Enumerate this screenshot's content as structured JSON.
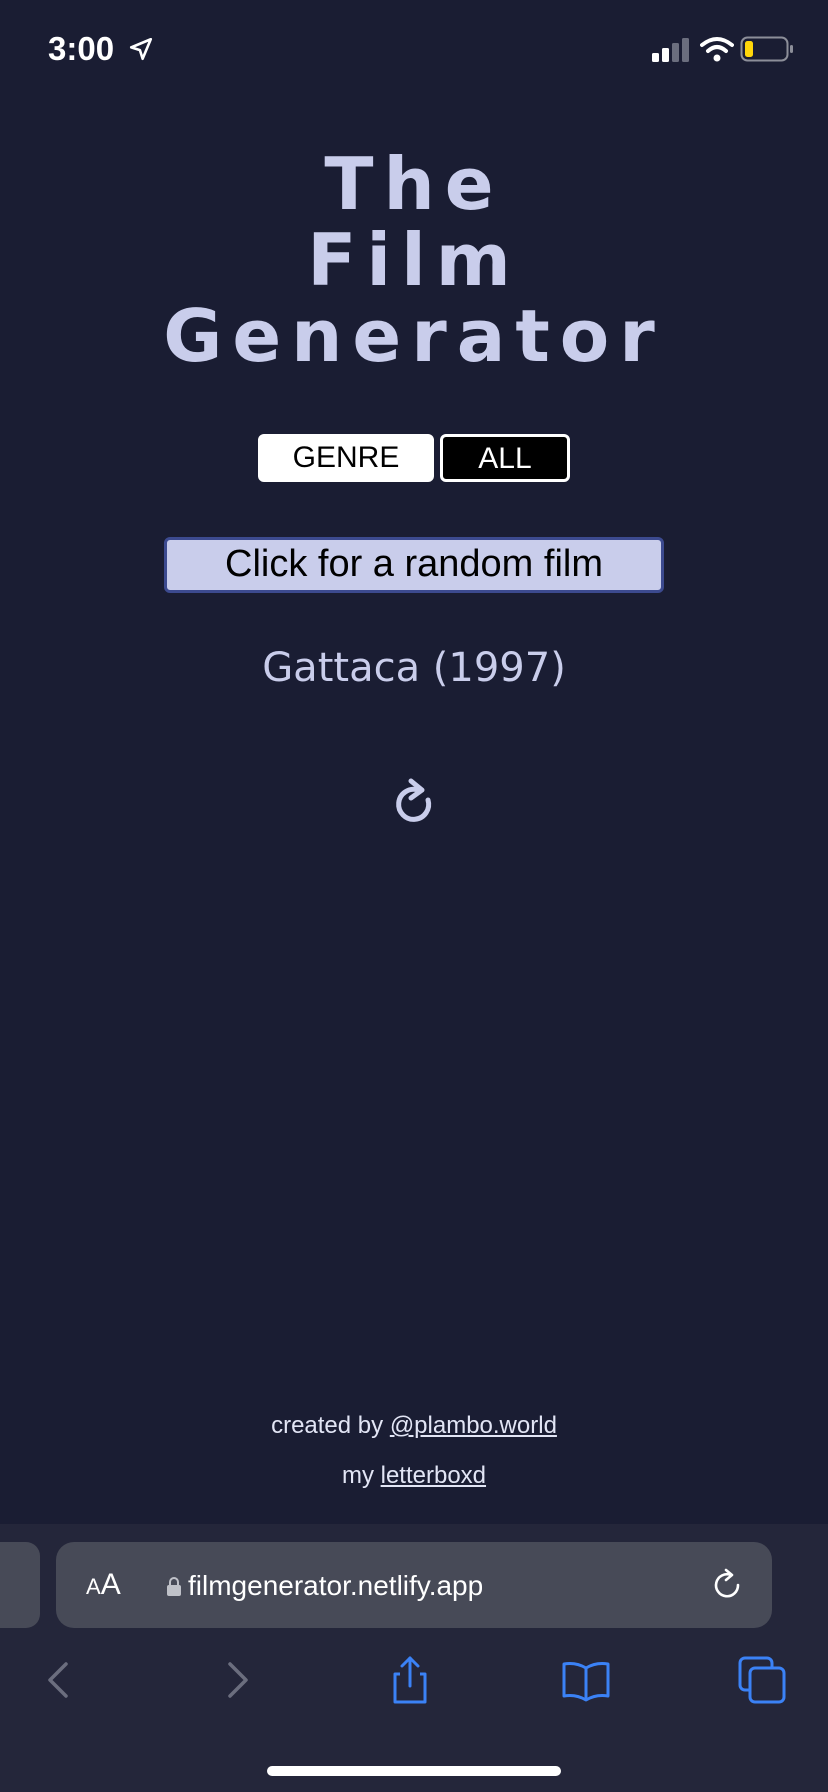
{
  "status_bar": {
    "time": "3:00",
    "icons": [
      "location-arrow-icon",
      "cellular-signal-icon",
      "wifi-icon",
      "battery-icon"
    ]
  },
  "page": {
    "title_lines": [
      "The",
      "Film",
      "Generator"
    ],
    "toggle": {
      "genre_label": "GENRE",
      "all_label": "ALL"
    },
    "random_button_label": "Click for a random film",
    "film_result": "Gattaca (1997)",
    "refresh_icon": "refresh-icon",
    "footer": {
      "created_by_prefix": "created by ",
      "created_by_link": "@plambo.world",
      "my_prefix": "my ",
      "letterboxd_link": "letterboxd"
    }
  },
  "browser": {
    "aa_label_small": "A",
    "aa_label_large": "A",
    "url": "filmgenerator.netlify.app",
    "toolbar_icons": [
      "back-icon",
      "forward-icon",
      "share-icon",
      "bookmarks-icon",
      "tabs-icon"
    ]
  },
  "colors": {
    "background": "#1a1d33",
    "text": "#c9cdeb",
    "button_bg": "#c9cdeb",
    "button_border": "#3c4a8f",
    "browser_bar": "#24263a",
    "url_field": "#474a57",
    "ios_blue": "#3b82f6"
  }
}
